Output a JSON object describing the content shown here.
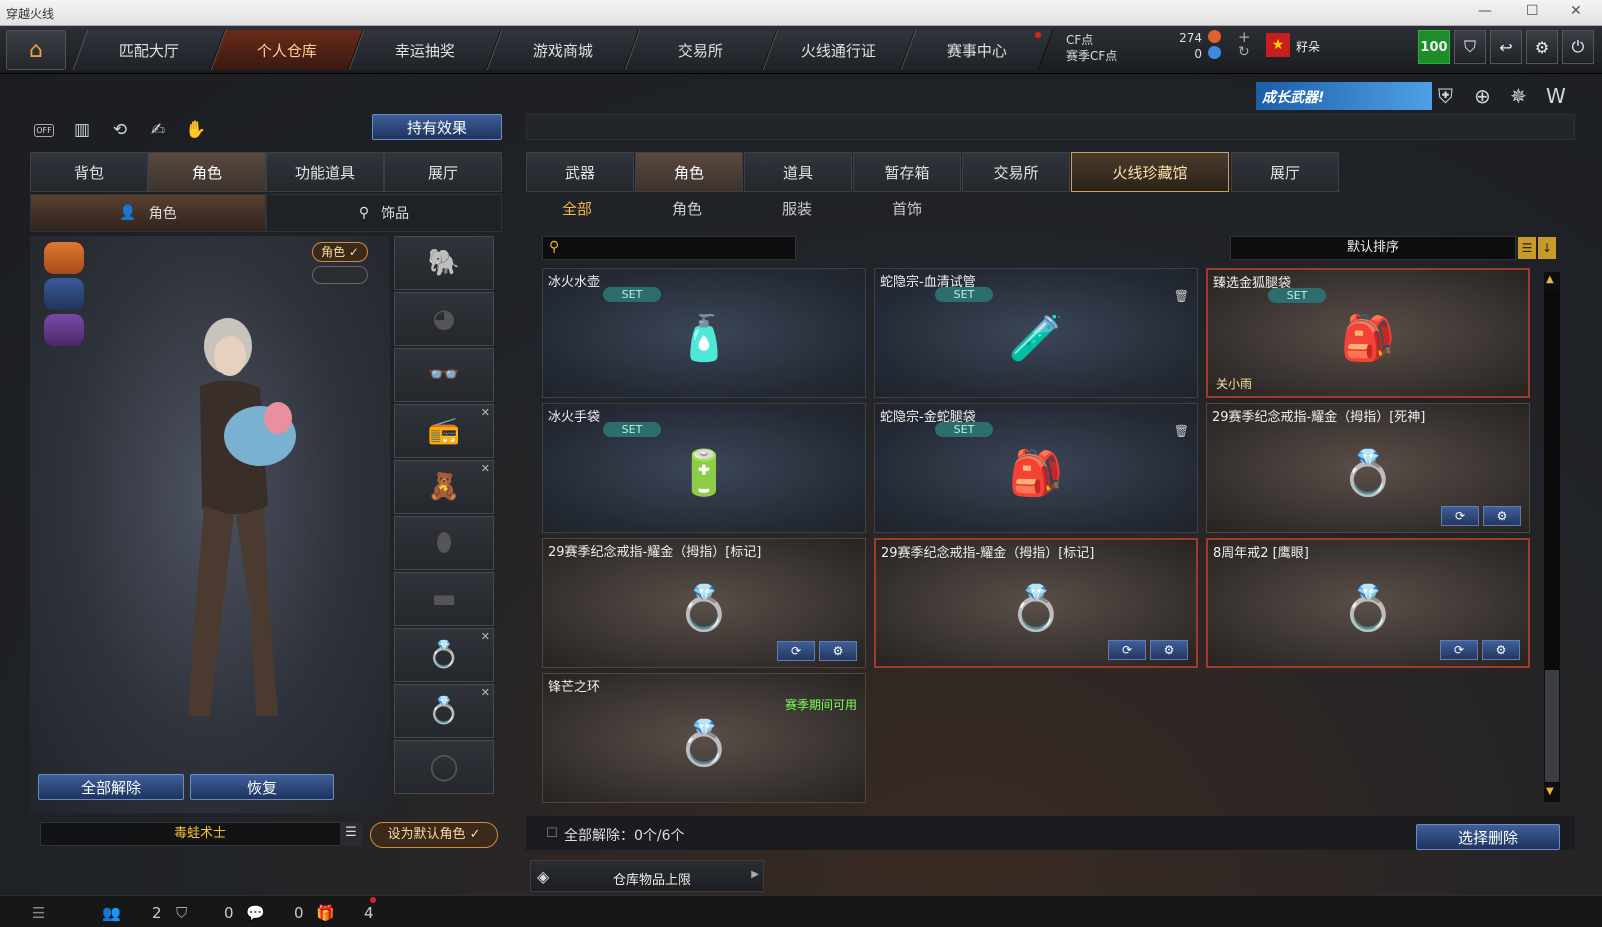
{
  "window": {
    "title": "穿越火线",
    "controls": [
      "—",
      "☐",
      "✕"
    ]
  },
  "nav": {
    "tabs": [
      {
        "label": "匹配大厅"
      },
      {
        "label": "个人仓库"
      },
      {
        "label": "幸运抽奖"
      },
      {
        "label": "游戏商城"
      },
      {
        "label": "交易所"
      },
      {
        "label": "火线通行证"
      },
      {
        "label": "赛事中心"
      }
    ],
    "active_index": 1
  },
  "currency": {
    "cf_label": "CF点",
    "cf_value": "274",
    "season_label": "赛季CF点",
    "season_value": "0"
  },
  "user": {
    "name": "籽朵",
    "level": "100"
  },
  "banner": {
    "text": "成长武器!"
  },
  "left": {
    "effect_button": "持有效果",
    "off_label": "OFF",
    "tabs": [
      {
        "label": "背包"
      },
      {
        "label": "角色"
      },
      {
        "label": "功能道具"
      },
      {
        "label": "展厅"
      }
    ],
    "active_tab": 1,
    "subtabs": [
      {
        "label": "角色"
      },
      {
        "label": "饰品"
      }
    ],
    "char_badge": "角色 ✓",
    "unequip_all": "全部解除",
    "restore": "恢复",
    "char_name": "毒蛙术士",
    "set_default": "设为默认角色 ✓"
  },
  "right": {
    "tabs": [
      {
        "label": "武器"
      },
      {
        "label": "角色"
      },
      {
        "label": "道具"
      },
      {
        "label": "暂存箱"
      },
      {
        "label": "交易所"
      },
      {
        "label": "火线珍藏馆"
      },
      {
        "label": "展厅"
      }
    ],
    "active_tab": 5,
    "filters": [
      {
        "label": "全部"
      },
      {
        "label": "角色"
      },
      {
        "label": "服装"
      },
      {
        "label": "首饰"
      }
    ],
    "active_filter": 0,
    "search_placeholder": "",
    "sort_label": "默认排序",
    "unequip_status": "全部解除：0个/6个",
    "select_delete": "选择删除",
    "capacity_label": "仓库物品上限"
  },
  "items": [
    {
      "name": "冰火水壶",
      "set": "SET",
      "style": "blue",
      "icon": "🧴"
    },
    {
      "name": "蛇隐宗-血清试管",
      "set": "SET",
      "style": "blue",
      "icon": "🧪",
      "trash": true
    },
    {
      "name": "臻选金狐腿袋",
      "set": "SET",
      "style": "brown-red",
      "icon": "🎒",
      "owner": "关小雨"
    },
    {
      "name": "冰火手袋",
      "set": "SET",
      "style": "blue",
      "icon": "🔋"
    },
    {
      "name": "蛇隐宗-金蛇腿袋",
      "set": "SET",
      "style": "blue",
      "icon": "🎒",
      "trash": true
    },
    {
      "name": "29赛季纪念戒指-耀金（拇指）[死神]",
      "style": "brown",
      "icon": "💍",
      "buttons": true
    },
    {
      "name": "29赛季纪念戒指-耀金（拇指）[标记]",
      "style": "brown",
      "icon": "💍",
      "buttons": true
    },
    {
      "name": "29赛季纪念戒指-耀金（拇指）[标记]",
      "style": "brown-red",
      "icon": "💍",
      "buttons": true
    },
    {
      "name": "8周年戒2 [鹰眼]",
      "style": "brown-red",
      "icon": "💍",
      "buttons": true
    },
    {
      "name": "锋芒之环",
      "style": "brown",
      "icon": "💍",
      "season": "赛季期间可用"
    }
  ],
  "status": {
    "count1": "2",
    "count2": "0",
    "count3": "0",
    "count4": "4"
  }
}
